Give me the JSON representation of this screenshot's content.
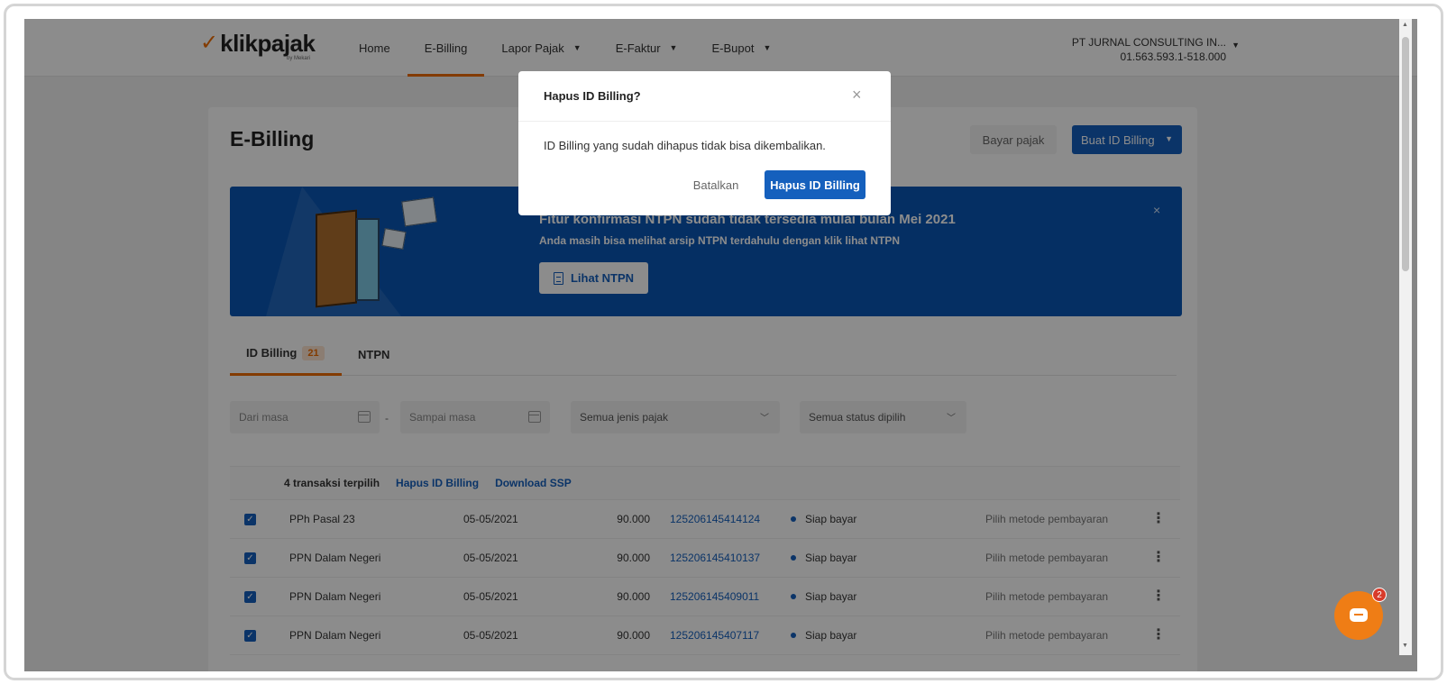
{
  "header": {
    "logo_word": "klikpajak",
    "logo_sub": "by Mekari",
    "nav": [
      {
        "label": "Home",
        "dropdown": false,
        "active": false
      },
      {
        "label": "E-Billing",
        "dropdown": false,
        "active": true
      },
      {
        "label": "Lapor Pajak",
        "dropdown": true,
        "active": false
      },
      {
        "label": "E-Faktur",
        "dropdown": true,
        "active": false
      },
      {
        "label": "E-Bupot",
        "dropdown": true,
        "active": false
      }
    ],
    "account_name": "PT JURNAL CONSULTING IN...",
    "account_npwp": "01.563.593.1-518.000"
  },
  "page": {
    "title": "E-Billing",
    "bayar_label": "Bayar pajak",
    "buat_label": "Buat ID Billing"
  },
  "banner": {
    "title": "Fitur konfirmasi NTPN sudah tidak tersedia mulai bulan Mei 2021",
    "desc": "Anda masih bisa melihat arsip NTPN terdahulu dengan klik lihat NTPN",
    "button": "Lihat NTPN",
    "close": "×"
  },
  "tabs": [
    {
      "label": "ID Billing",
      "badge": "21"
    },
    {
      "label": "NTPN",
      "badge": ""
    }
  ],
  "filters": {
    "from": "Dari masa",
    "to": "Sampai masa",
    "dash": "-",
    "jenis": "Semua jenis pajak",
    "status": "Semua status dipilih"
  },
  "table": {
    "selected": "4 transaksi terpilih",
    "hapus_link": "Hapus ID Billing",
    "download_link": "Download SSP",
    "rows": [
      {
        "jenis": "PPh Pasal 23",
        "tanggal": "05-05/2021",
        "jumlah": "90.000",
        "id": "125206145414124",
        "status": "Siap bayar",
        "metode": "Pilih metode pembayaran"
      },
      {
        "jenis": "PPN Dalam Negeri",
        "tanggal": "05-05/2021",
        "jumlah": "90.000",
        "id": "125206145410137",
        "status": "Siap bayar",
        "metode": "Pilih metode pembayaran"
      },
      {
        "jenis": "PPN Dalam Negeri",
        "tanggal": "05-05/2021",
        "jumlah": "90.000",
        "id": "125206145409011",
        "status": "Siap bayar",
        "metode": "Pilih metode pembayaran"
      },
      {
        "jenis": "PPN Dalam Negeri",
        "tanggal": "05-05/2021",
        "jumlah": "90.000",
        "id": "125206145407117",
        "status": "Siap bayar",
        "metode": "Pilih metode pembayaran"
      }
    ]
  },
  "modal": {
    "title": "Hapus ID Billing?",
    "close": "×",
    "body": "ID Billing yang sudah dihapus tidak bisa dikembalikan.",
    "cancel": "Batalkan",
    "confirm": "Hapus ID Billing"
  },
  "chat": {
    "badge": "2"
  },
  "colors": {
    "brand_orange": "#ef6c00",
    "primary_blue": "#1560bd",
    "banner_blue": "#0a56b5"
  }
}
